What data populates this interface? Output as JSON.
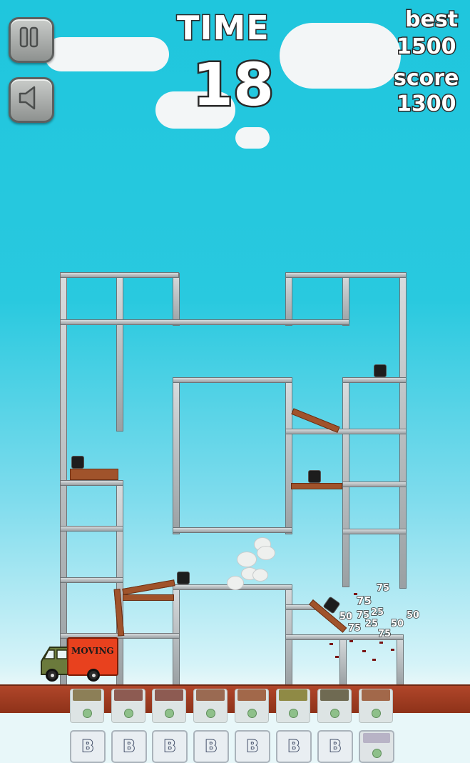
{
  "hud": {
    "time_label": "TIME",
    "time_value": "18",
    "best_label": "best",
    "best_value": "1500",
    "score_label": "score",
    "score_value": "1300"
  },
  "buttons": {
    "pause_icon": "pause-icon",
    "sound_icon": "speaker-icon"
  },
  "truck": {
    "sign": "MOVING"
  },
  "popups": [
    "75",
    "75",
    "25",
    "50",
    "75",
    "50",
    "75",
    "50",
    "75",
    "25",
    "50",
    "50"
  ],
  "inventory": {
    "slots": [
      {
        "color": "#8c7f57"
      },
      {
        "color": "#8d5b52"
      },
      {
        "color": "#8d5b52"
      },
      {
        "color": "#9a6a52"
      },
      {
        "color": "#a2684a"
      },
      {
        "color": "#8f8a45"
      },
      {
        "color": "#6f6a52"
      },
      {
        "color": "#a2684a"
      }
    ],
    "bomb_buttons": [
      "B",
      "B",
      "B",
      "B",
      "B",
      "B",
      "B"
    ]
  },
  "colors": {
    "sky": "#1fc6dd",
    "ground": "#a33f24",
    "truck_body": "#e8411e"
  }
}
